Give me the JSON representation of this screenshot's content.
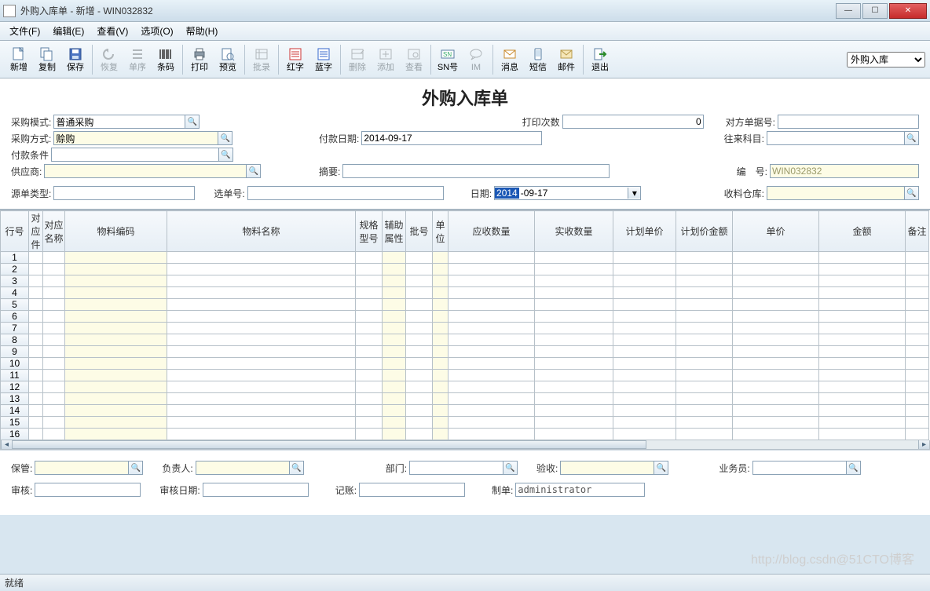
{
  "window": {
    "title": "外购入库单 - 新增 - WIN032832"
  },
  "menu": {
    "file": "文件(F)",
    "edit": "编辑(E)",
    "view": "查看(V)",
    "options": "选项(O)",
    "help": "帮助(H)"
  },
  "toolbar": {
    "new": "新增",
    "copy": "复制",
    "save": "保存",
    "recover": "恢复",
    "order": "单序",
    "barcode": "条码",
    "print": "打印",
    "preview": "预览",
    "batch": "批录",
    "red": "红字",
    "blue": "蓝字",
    "delete": "删除",
    "add": "添加",
    "find": "查看",
    "sn": "SN号",
    "im": "IM",
    "msg": "消息",
    "sms": "短信",
    "mail": "邮件",
    "exit": "退出"
  },
  "doctype_selected": "外购入库",
  "doc_title": "外购入库单",
  "form": {
    "purchase_mode_label": "采购模式:",
    "purchase_mode_value": "普通采购",
    "print_count_label": "打印次数",
    "print_count_value": "0",
    "peer_doc_label": "对方单据号:",
    "peer_doc_value": "",
    "purchase_way_label": "采购方式:",
    "purchase_way_value": "赊购",
    "pay_date_label": "付款日期:",
    "pay_date_value": "2014-09-17",
    "account_subject_label": "往来科目:",
    "account_subject_value": "",
    "pay_terms_label": "付款条件",
    "pay_terms_value": "",
    "supplier_label": "供应商:",
    "supplier_value": "",
    "summary_label": "摘要:",
    "summary_value": "",
    "code_label": "编　号:",
    "code_value": "WIN032832",
    "src_type_label": "源单类型:",
    "src_type_value": "",
    "select_doc_label": "选单号:",
    "select_doc_value": "",
    "date_label": "日期:",
    "date_sel": "2014",
    "date_rest": "-09-17",
    "warehouse_label": "收料仓库:",
    "warehouse_value": ""
  },
  "grid": {
    "headers": [
      "行号",
      "对应件",
      "对应名称",
      "物料编码",
      "物料名称",
      "规格型号",
      "辅助属性",
      "批号",
      "单位",
      "应收数量",
      "实收数量",
      "计划单价",
      "计划价金额",
      "单价",
      "金额",
      "备注"
    ],
    "widths": [
      36,
      18,
      28,
      130,
      240,
      34,
      30,
      34,
      20,
      110,
      100,
      80,
      72,
      110,
      110,
      30
    ],
    "highlight_cols": [
      3,
      6,
      8
    ],
    "row_count": 16
  },
  "footer": {
    "keeper_label": "保管:",
    "manager_label": "负责人:",
    "dept_label": "部门:",
    "check_label": "验收:",
    "sales_label": "业务员:",
    "audit_label": "审核:",
    "audit_date_label": "审核日期:",
    "book_label": "记账:",
    "maker_label": "制单:",
    "maker_value": "administrator"
  },
  "status": "就绪",
  "watermark": "http://blog.csdn@51CTO博客"
}
